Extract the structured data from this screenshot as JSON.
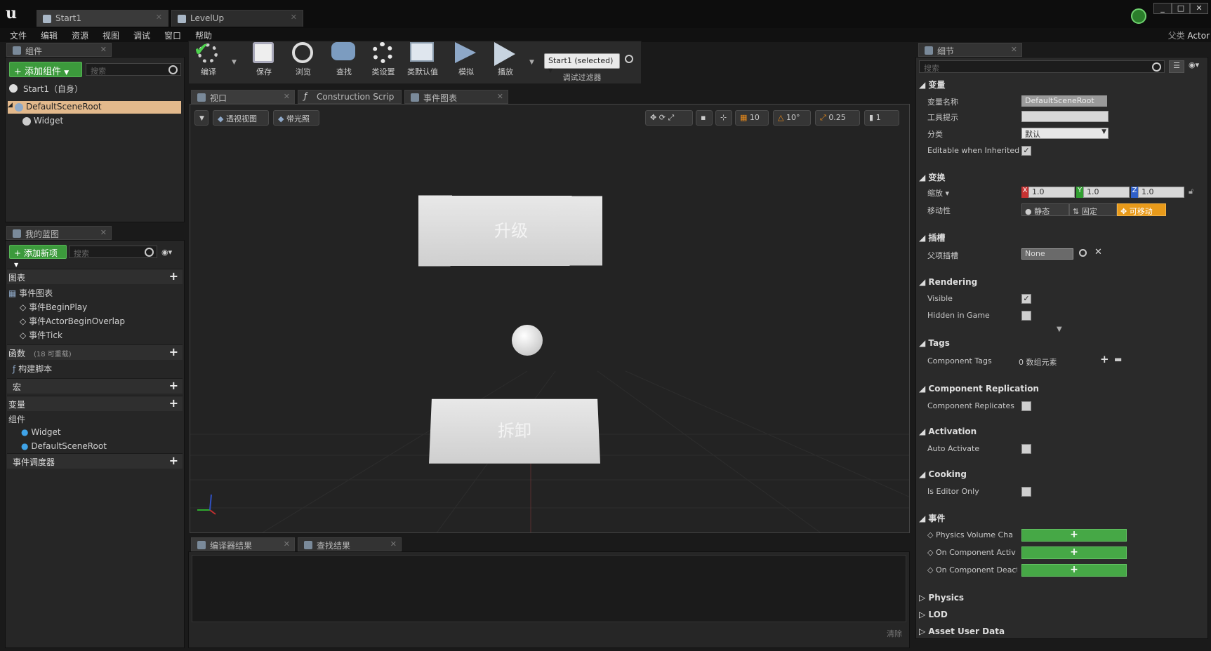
{
  "titlebar": {
    "logo": "u",
    "tabs": [
      {
        "label": "Start1"
      },
      {
        "label": "LevelUp"
      }
    ],
    "window_buttons": [
      "_",
      "□",
      "✕"
    ]
  },
  "menubar": {
    "items": [
      "文件",
      "编辑",
      "资源",
      "视图",
      "调试",
      "窗口",
      "帮助"
    ],
    "parent_label": "父类",
    "parent_value": "Actor"
  },
  "components_panel": {
    "tab": "组件",
    "add_button": "添加组件",
    "search_placeholder": "搜索",
    "root_item": "Start1（自身）",
    "items": [
      "DefaultSceneRoot",
      "Widget"
    ]
  },
  "blueprint_panel": {
    "tab": "我的蓝图",
    "add_button": "添加新项",
    "search_placeholder": "搜索",
    "graphs_header": "图表",
    "event_graph": "事件图表",
    "events": [
      "事件BeginPlay",
      "事件ActorBeginOverlap",
      "事件Tick"
    ],
    "functions_header": "函数",
    "functions_note": "(18 可重载)",
    "construction_script": "构建脚本",
    "macros_header": "宏",
    "variables_header": "变量",
    "components_group": "组件",
    "component_vars": [
      "Widget",
      "DefaultSceneRoot"
    ],
    "dispatchers_header": "事件调度器"
  },
  "toolbar": {
    "buttons": [
      {
        "label": "编译"
      },
      {
        "label": "保存"
      },
      {
        "label": "浏览"
      },
      {
        "label": "查找"
      },
      {
        "label": "类设置"
      },
      {
        "label": "类默认值"
      },
      {
        "label": "模拟"
      },
      {
        "label": "播放"
      }
    ],
    "debug_select": "Start1 (selected)",
    "debug_filter_label": "调试过滤器"
  },
  "editor_tabs": [
    {
      "label": "视口"
    },
    {
      "label": "Construction Scrip"
    },
    {
      "label": "事件图表"
    }
  ],
  "viewport": {
    "perspective": "透视视图",
    "lighting": "带光照",
    "grid_snap": "10",
    "rotation_snap": "10°",
    "scale_snap": "0.25",
    "camera_speed": "1",
    "widget_top": "升级",
    "widget_bottom": "拆卸"
  },
  "bottom_panel": {
    "tabs": [
      "编译器结果",
      "查找结果"
    ],
    "clear_label": "清除"
  },
  "details": {
    "tab": "细节",
    "search_placeholder": "搜索",
    "variables_section": "变量",
    "variable_name_label": "变量名称",
    "variable_name_value": "DefaultSceneRoot",
    "tooltip_label": "工具提示",
    "category_label": "分类",
    "category_value": "默认",
    "editable_label": "Editable when Inherited",
    "transform_section": "变换",
    "scale_label": "缩放",
    "scale_x": "1.0",
    "scale_y": "1.0",
    "scale_z": "1.0",
    "mobility_label": "移动性",
    "mobility_static": "静态",
    "mobility_stationary": "固定",
    "mobility_movable": "可移动",
    "sockets_section": "插槽",
    "parent_socket_label": "父项插槽",
    "parent_socket_value": "None",
    "rendering_section": "Rendering",
    "visible_label": "Visible",
    "hidden_label": "Hidden in Game",
    "tags_section": "Tags",
    "component_tags_label": "Component Tags",
    "component_tags_value": "0 数组元素",
    "replication_section": "Component Replication",
    "replicates_label": "Component Replicates",
    "activation_section": "Activation",
    "auto_activate_label": "Auto Activate",
    "cooking_section": "Cooking",
    "editor_only_label": "Is Editor Only",
    "events_section": "事件",
    "events": [
      "Physics Volume Cha",
      "On Component Activ",
      "On Component Deact"
    ],
    "physics_section": "Physics",
    "lod_section": "LOD",
    "asset_section": "Asset User Data"
  }
}
